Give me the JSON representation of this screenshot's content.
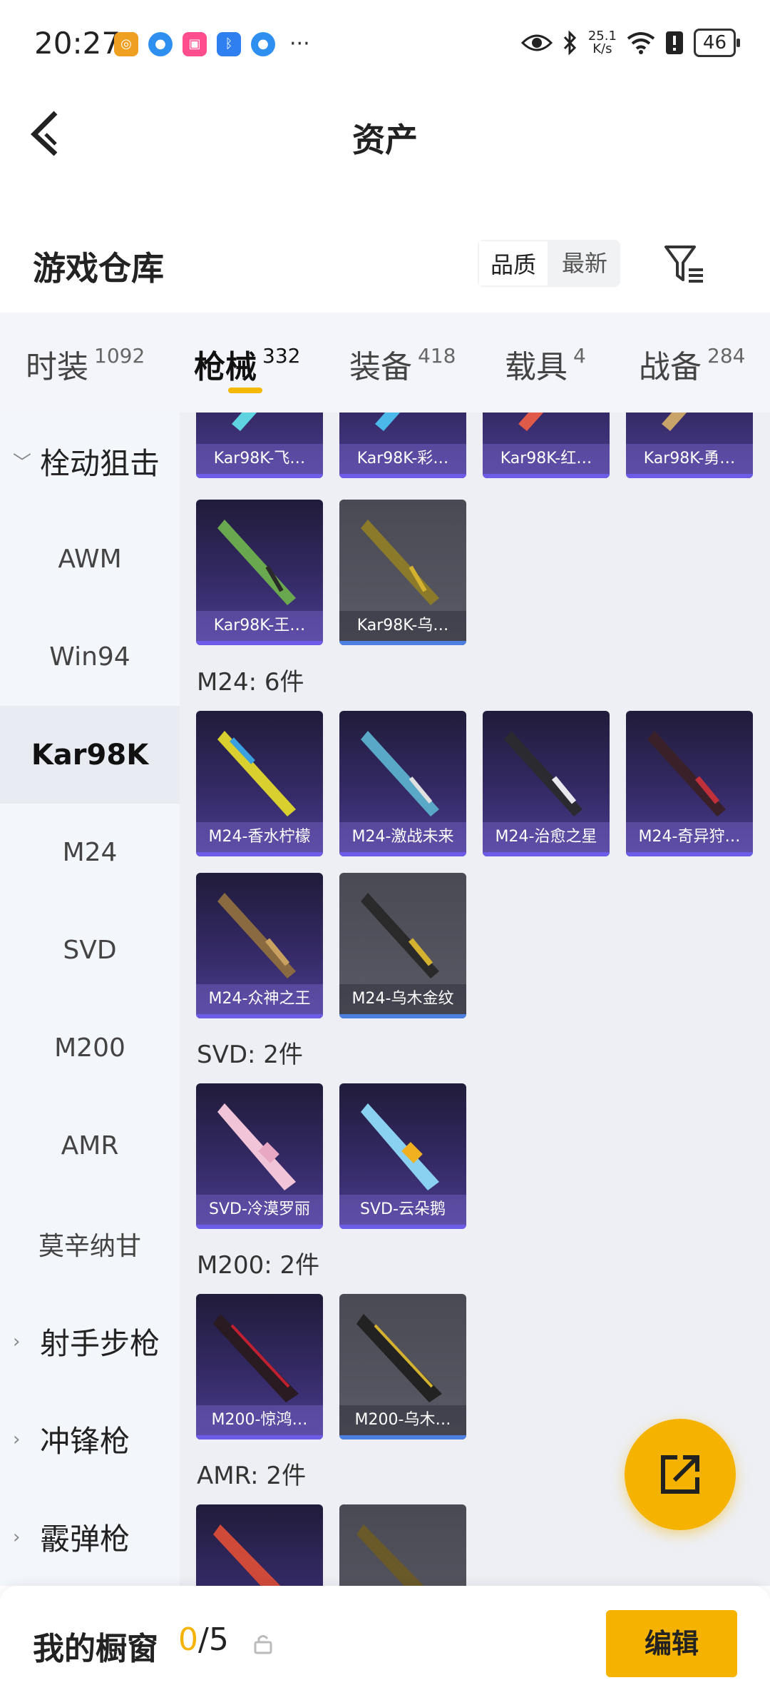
{
  "status_bar": {
    "time": "20:27",
    "more": "···",
    "net_speed_value": "25.1",
    "net_speed_unit": "K/s",
    "battery": "46"
  },
  "header": {
    "title": "资产"
  },
  "section": {
    "title": "游戏仓库",
    "sort_options": [
      "品质",
      "最新"
    ],
    "sort_selected": "品质"
  },
  "tabs": [
    {
      "label": "时装",
      "count": "1092"
    },
    {
      "label": "枪械",
      "count": "332",
      "active": true
    },
    {
      "label": "装备",
      "count": "418"
    },
    {
      "label": "载具",
      "count": "4"
    },
    {
      "label": "战备",
      "count": "284"
    }
  ],
  "sidebar": {
    "items": [
      {
        "label": "栓动狙击",
        "group": true,
        "expanded": true
      },
      {
        "label": "AWM"
      },
      {
        "label": "Win94"
      },
      {
        "label": "Kar98K",
        "active": true
      },
      {
        "label": "M24"
      },
      {
        "label": "SVD"
      },
      {
        "label": "M200"
      },
      {
        "label": "AMR"
      },
      {
        "label": "莫辛纳甘"
      },
      {
        "label": "射手步枪",
        "group": true
      },
      {
        "label": "冲锋枪",
        "group": true
      },
      {
        "label": "霰弹枪",
        "group": true
      }
    ]
  },
  "content": {
    "kar_row1": [
      "Kar98K-飞…",
      "Kar98K-彩…",
      "Kar98K-红…",
      "Kar98K-勇…"
    ],
    "kar_row2": [
      "Kar98K-王…",
      "Kar98K-乌…"
    ],
    "groups": [
      {
        "label": "M24: 6件",
        "items": [
          "M24-香水柠檬",
          "M24-激战未来",
          "M24-治愈之星",
          "M24-奇异狩…",
          "M24-众神之王",
          "M24-乌木金纹"
        ]
      },
      {
        "label": "SVD: 2件",
        "items": [
          "SVD-冷漠罗丽",
          "SVD-云朵鹅"
        ]
      },
      {
        "label": "M200: 2件",
        "items": [
          "M200-惊鸿…",
          "M200-乌木…"
        ]
      },
      {
        "label": "AMR: 2件",
        "items": [
          "",
          ""
        ]
      }
    ]
  },
  "bottom_bar": {
    "title": "我的橱窗",
    "current": "0",
    "total": "/5",
    "edit_label": "编辑"
  },
  "colors": {
    "accent": "#f5b300",
    "card_purple": "#352a66",
    "card_grey": "#5a5a66"
  },
  "icons": [
    "back-arrow-icon",
    "filter-icon",
    "lock-icon",
    "share-icon",
    "eye-icon",
    "bluetooth-icon",
    "wifi-icon"
  ]
}
